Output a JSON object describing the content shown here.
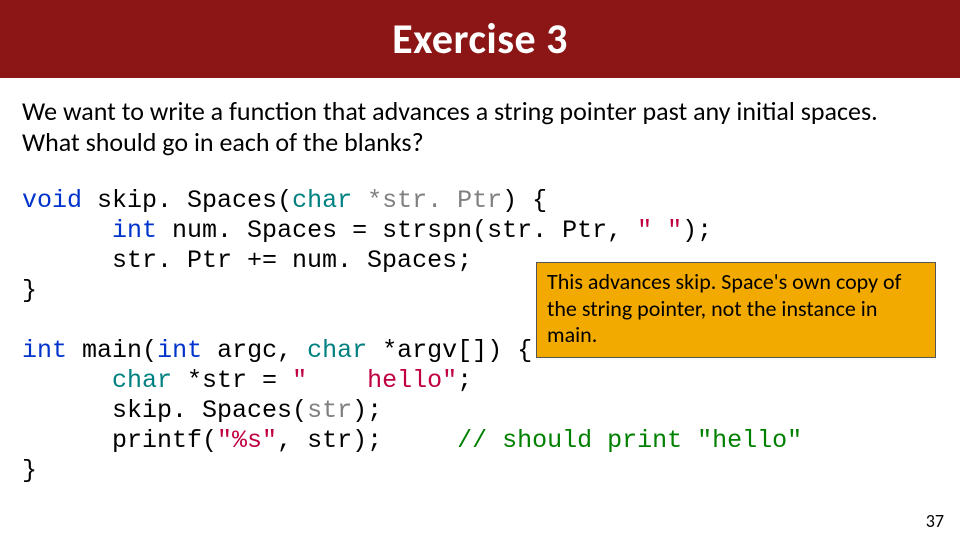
{
  "title": "Exercise 3",
  "prompt": "We want to write a function that advances a string pointer past any initial spaces.  What should go in each of the blanks?",
  "code": {
    "l1": {
      "kw": "void",
      "fn": "skip. Spaces",
      "ty": "char",
      "arg": "*str. Ptr"
    },
    "l2": {
      "kw": "int",
      "rest": "num. Spaces = strspn(str. Ptr, ",
      "str": "\" \"",
      "end": ");"
    },
    "l3": "str. Ptr += num. Spaces;",
    "l5": {
      "kw": "int",
      "fn": "main",
      "kw2": "int",
      "argc": "argc",
      "ty": "char",
      "argv": "*argv[]"
    },
    "l6": {
      "ty": "char",
      "decl": "*str = ",
      "str": "\"    hello\"",
      "end": ";"
    },
    "l7": {
      "call": "skip. Spaces(",
      "arg": "str",
      "end": ");"
    },
    "l8": {
      "call": "printf(",
      "str": "\"%s\"",
      "rest": ", str);",
      "cmt": "// should print \"hello\""
    }
  },
  "callout": "This advances skip. Space's own copy of the string pointer, not the instance in main.",
  "page": "37"
}
